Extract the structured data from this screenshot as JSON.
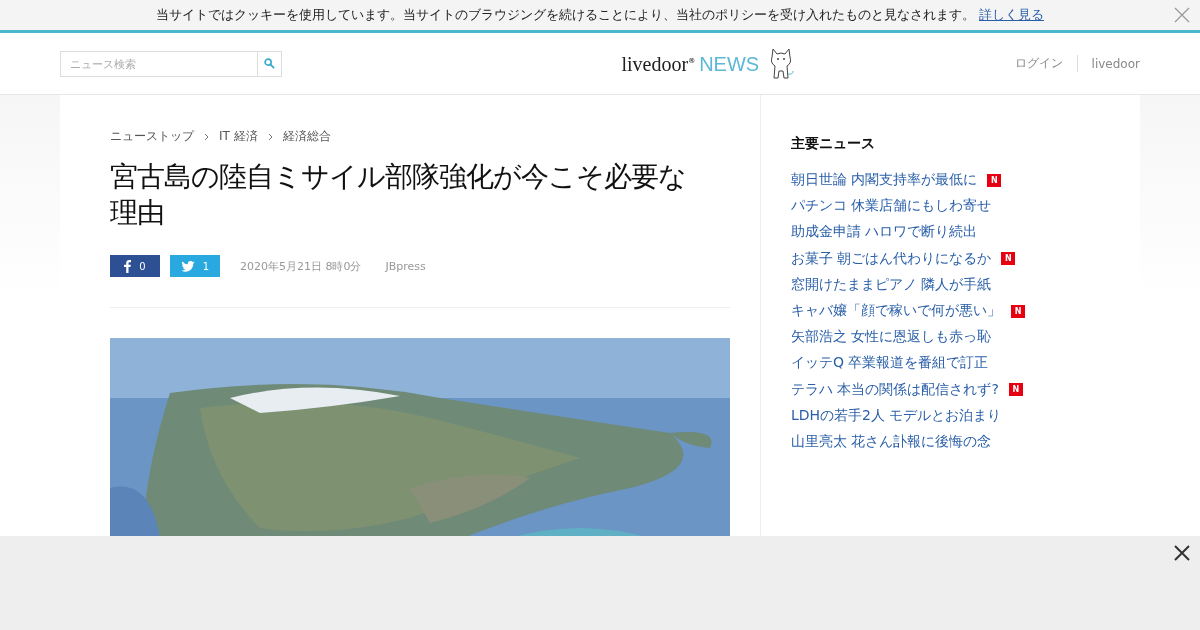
{
  "cookie_bar": {
    "message": "当サイトではクッキーを使用しています。当サイトのブラウジングを続けることにより、当社のポリシーを受け入れたものと見なされます。",
    "link": "詳しく見る"
  },
  "header": {
    "search": {
      "placeholder": "ニュース検索"
    },
    "logo": {
      "brand": "livedoor",
      "mark": "®",
      "section": "NEWS"
    },
    "links": [
      "ログイン",
      "livedoor"
    ]
  },
  "breadcrumbs": [
    "ニューストップ",
    "IT 経済",
    "経済総合"
  ],
  "article": {
    "title": "宮古島の陸自ミサイル部隊強化が今こそ必要な理由",
    "shares": [
      {
        "kind": "facebook",
        "count": "0"
      },
      {
        "kind": "twitter",
        "count": "1"
      }
    ],
    "date": "2020年5月21日 8時0分",
    "source": "JBpress"
  },
  "sidebar": {
    "title": "主要ニュース",
    "items": [
      {
        "text": "朝日世論 内閣支持率が最低に",
        "badge": "N"
      },
      {
        "text": "パチンコ 休業店舗にもしわ寄せ"
      },
      {
        "text": "助成金申請 ハロワで断り続出"
      },
      {
        "text": "お菓子 朝ごはん代わりになるか",
        "badge": "N"
      },
      {
        "text": "窓開けたままピアノ 隣人が手紙"
      },
      {
        "text": "キャバ嬢「顔で稼いで何が悪い」",
        "badge": "N"
      },
      {
        "text": "矢部浩之 女性に恩返しも赤っ恥"
      },
      {
        "text": "イッテQ 卒業報道を番組で訂正"
      },
      {
        "text": "テラハ 本当の関係は配信されず?",
        "badge": "N"
      },
      {
        "text": "LDHの若手2人 モデルとお泊まり"
      },
      {
        "text": "山里亮太 花さん訃報に後悔の念"
      }
    ]
  },
  "ad_overlay": {
    "closable": true
  }
}
